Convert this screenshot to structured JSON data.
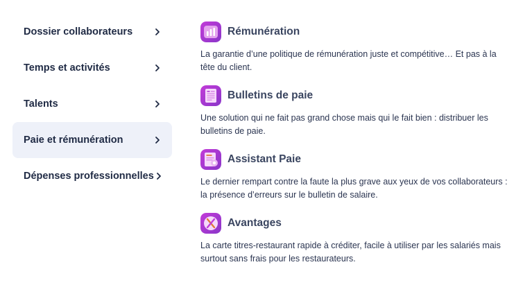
{
  "sidebar": {
    "items": [
      {
        "label": "Dossier collaborateurs"
      },
      {
        "label": "Temps et activités"
      },
      {
        "label": "Talents"
      },
      {
        "label": "Paie et rémunération"
      },
      {
        "label": "Dépenses professionnelles"
      }
    ]
  },
  "content": {
    "blocks": [
      {
        "icon": "bar-chart-icon",
        "title": "Rémunération",
        "description": "La garantie d’une politique de rémunération juste et compétitive… Et pas à la tête du client."
      },
      {
        "icon": "payslip-document-icon",
        "title": "Bulletins de paie",
        "description": "Une solution qui ne fait pas grand chose mais qui le fait bien : distribuer les bulletins de paie."
      },
      {
        "icon": "assistant-document-icon",
        "title": "Assistant Paie",
        "description": "Le dernier rempart contre la faute la plus grave aux yeux de vos collaborateurs : la présence d’erreurs sur le bulletin de salaire."
      },
      {
        "icon": "cutlery-icon",
        "title": "Avantages",
        "description": "La carte titres-restaurant rapide à créditer, facile à utiliser par les salariés mais surtout sans frais pour les restaurateurs."
      }
    ]
  },
  "colors": {
    "active_bg": "#eef1f9",
    "icon_gradient_start": "#c23bd8",
    "icon_gradient_end": "#8a36c9",
    "text": "#1f2a44"
  }
}
